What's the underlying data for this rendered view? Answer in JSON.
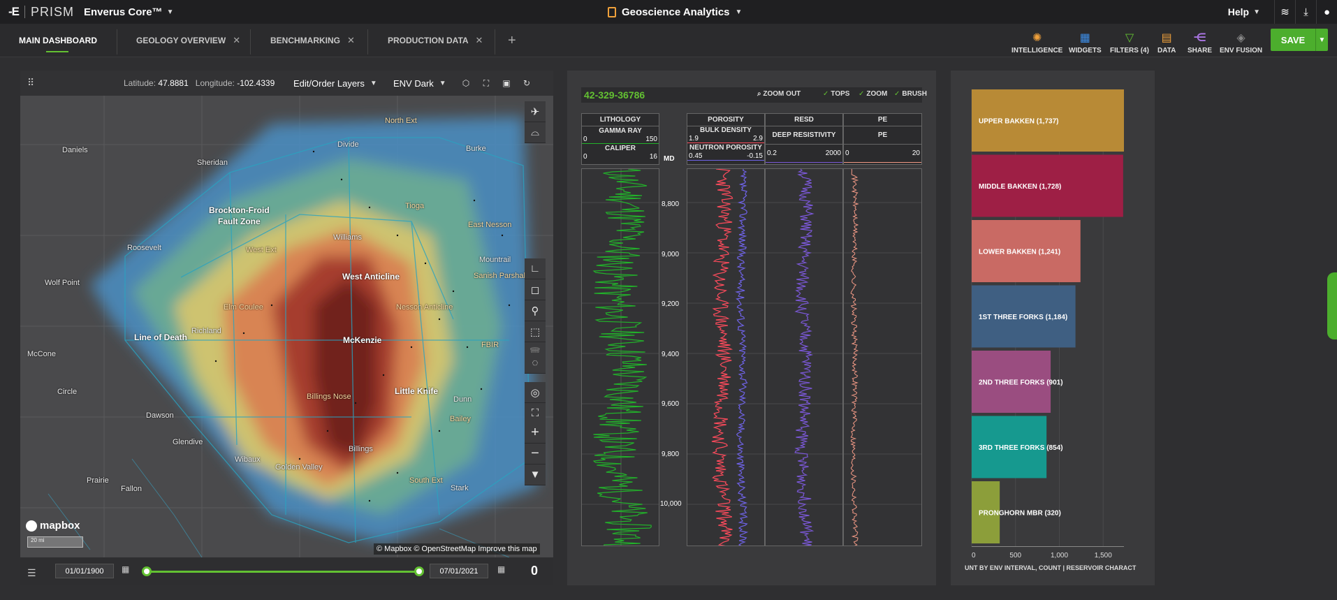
{
  "topbar": {
    "logo_mark": "-E",
    "logo_text": "PRISM",
    "product": "Enverus Core™",
    "center_title": "Geoscience Analytics",
    "help": "Help"
  },
  "tabs": [
    {
      "label": "MAIN DASHBOARD",
      "closable": false,
      "active": true
    },
    {
      "label": "GEOLOGY OVERVIEW",
      "closable": true
    },
    {
      "label": "BENCHMARKING",
      "closable": true
    },
    {
      "label": "PRODUCTION DATA",
      "closable": true
    }
  ],
  "toolbar": {
    "intelligence": "INTELLIGENCE",
    "widgets": "WIDGETS",
    "filters": "FILTERS (4)",
    "data": "DATA",
    "share": "SHARE",
    "env_fusion": "ENV FUSION",
    "save": "SAVE"
  },
  "map": {
    "latitude_label": "Latitude:",
    "latitude": "47.8881",
    "longitude_label": "Longitude:",
    "longitude": "-102.4339",
    "layers_dropdown": "Edit/Order Layers",
    "style_dropdown": "ENV Dark",
    "labels": [
      {
        "text": "North Ext",
        "cls": "city"
      },
      {
        "text": "Divide",
        "cls": ""
      },
      {
        "text": "Burke",
        "cls": ""
      },
      {
        "text": "Daniels",
        "cls": ""
      },
      {
        "text": "Sheridan",
        "cls": ""
      },
      {
        "text": "Brockton-Froid",
        "cls": "big"
      },
      {
        "text": "Fault Zone",
        "cls": "big"
      },
      {
        "text": "Tioga",
        "cls": "city"
      },
      {
        "text": "East Nesson",
        "cls": "city"
      },
      {
        "text": "Williams",
        "cls": ""
      },
      {
        "text": "Roosevelt",
        "cls": ""
      },
      {
        "text": "West Ext",
        "cls": "city"
      },
      {
        "text": "Mountrail",
        "cls": ""
      },
      {
        "text": "Sanish Parshall",
        "cls": "city"
      },
      {
        "text": "West Anticline",
        "cls": "big"
      },
      {
        "text": "Wolf Point",
        "cls": ""
      },
      {
        "text": "Nesson Anticline",
        "cls": "city"
      },
      {
        "text": "Elm Coulee",
        "cls": "city"
      },
      {
        "text": "Richland",
        "cls": ""
      },
      {
        "text": "Line of Death",
        "cls": "big"
      },
      {
        "text": "McKenzie",
        "cls": "big"
      },
      {
        "text": "FBIR",
        "cls": "city"
      },
      {
        "text": "McCone",
        "cls": ""
      },
      {
        "text": "Billings Nose",
        "cls": "city"
      },
      {
        "text": "Little Knife",
        "cls": "big"
      },
      {
        "text": "Dunn",
        "cls": ""
      },
      {
        "text": "Circle",
        "cls": ""
      },
      {
        "text": "Dawson",
        "cls": ""
      },
      {
        "text": "Bailey",
        "cls": "city"
      },
      {
        "text": "Glendive",
        "cls": ""
      },
      {
        "text": "Billings",
        "cls": ""
      },
      {
        "text": "Wibaux",
        "cls": ""
      },
      {
        "text": "Golden Valley",
        "cls": ""
      },
      {
        "text": "Prairie",
        "cls": ""
      },
      {
        "text": "Fallon",
        "cls": ""
      },
      {
        "text": "South Ext",
        "cls": "city"
      },
      {
        "text": "Stark",
        "cls": ""
      }
    ],
    "brand": "mapbox",
    "scale": "20 mi",
    "attribution": "© Mapbox © OpenStreetMap Improve this map",
    "start_date": "01/01/1900",
    "end_date": "07/01/2021",
    "count": "0"
  },
  "well_log": {
    "well_id": "42-329-36786",
    "zoom_out": "ZOOM OUT",
    "tops": "TOPS",
    "zoom": "ZOOM",
    "brush": "BRUSH",
    "tracks": {
      "lithology": {
        "title": "LITHOLOGY",
        "curve1": "GAMMA RAY",
        "c1_min": "0",
        "c1_max": "150",
        "curve2": "CALIPER",
        "c2_min": "0",
        "c2_max": "16"
      },
      "md": "MD",
      "porosity": {
        "title": "POROSITY",
        "curve1": "BULK DENSITY",
        "c1_min": "1.9",
        "c1_max": "2.9",
        "curve2": "NEUTRON POROSITY",
        "c2_min": "0.45",
        "c2_max": "-0.15"
      },
      "resd": {
        "title": "RESD",
        "curve1": "DEEP RESISTIVITY",
        "c1_min": "0.2",
        "c1_max": "2000"
      },
      "pe": {
        "title": "PE",
        "curve1": "PE",
        "c1_min": "0",
        "c1_max": "20"
      }
    },
    "depths": [
      "8,800",
      "9,000",
      "9,200",
      "9,400",
      "9,600",
      "9,800",
      "10,000"
    ],
    "colors": {
      "gamma": "#22b22a",
      "density": "#ff4b5c",
      "neutron": "#6f63e8",
      "resistivity": "#7b58d8",
      "pe": "#f29a86"
    }
  },
  "chart_data": {
    "type": "bar",
    "orientation": "horizontal",
    "categories": [
      "UPPER BAKKEN (1,737)",
      "MIDDLE BAKKEN (1,728)",
      "LOWER BAKKEN (1,241)",
      "1ST THREE FORKS (1,184)",
      "2ND THREE FORKS (901)",
      "3RD THREE FORKS (854)",
      "PRONGHORN MBR (320)"
    ],
    "values": [
      1737,
      1728,
      1241,
      1184,
      901,
      854,
      320
    ],
    "colors": [
      "#b88a36",
      "#9e1f45",
      "#c96a64",
      "#3f5f82",
      "#9a4d80",
      "#16998f",
      "#8c9e3a"
    ],
    "xlim": [
      0,
      1737
    ],
    "xticks": [
      "0",
      "500",
      "1,000",
      "1,500"
    ],
    "xtick_values": [
      0,
      500,
      1000,
      1500
    ],
    "xlabel": "UNT BY ENV INTERVAL, COUNT | RESERVOIR CHARACT"
  }
}
